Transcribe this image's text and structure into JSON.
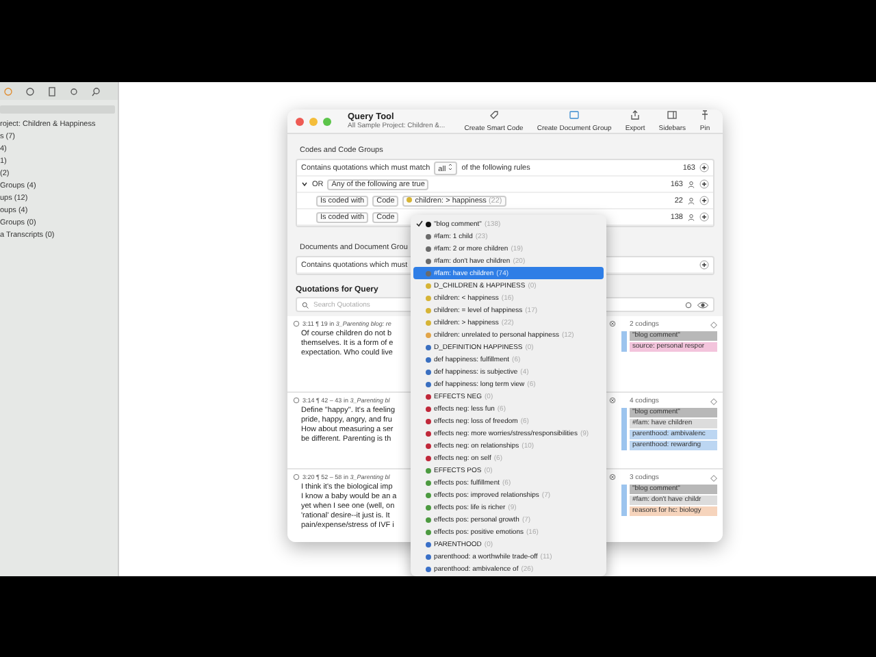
{
  "sidebar": {
    "items": [
      "roject: Children & Happiness",
      "s (7)",
      "4)",
      "1)",
      "(2)",
      "Groups (4)",
      "ups (12)",
      "oups (4)",
      "Groups (0)",
      "a Transcripts (0)"
    ]
  },
  "window": {
    "title": "Query Tool",
    "subtitle": "All Sample Project: Children &...",
    "toolbar": [
      {
        "kind": "smart-code",
        "label": "Create Smart Code"
      },
      {
        "kind": "document-group",
        "label": "Create Document Group"
      },
      {
        "kind": "export",
        "label": "Export"
      },
      {
        "kind": "sidebars",
        "label": "Sidebars"
      },
      {
        "kind": "pin",
        "label": "Pin"
      }
    ]
  },
  "codes_section": {
    "title": "Codes and Code Groups",
    "rules": [
      {
        "kind": "match",
        "text_before": "Contains quotations which must match",
        "choice": "all",
        "text_after": "of the following rules",
        "count": "163"
      },
      {
        "kind": "group",
        "expanded": true,
        "operator": "OR",
        "choice": "Any of the following are true",
        "count": "163"
      },
      {
        "kind": "condition",
        "field": "Is coded with",
        "type": "Code",
        "code": "children: > happiness",
        "code_count": "(22)",
        "count": "22"
      },
      {
        "kind": "condition",
        "field": "Is coded with",
        "type": "Code",
        "count": "138"
      }
    ]
  },
  "documents_section": {
    "title": "Documents and Document Grou",
    "rule": "Contains quotations which must"
  },
  "quotations": {
    "title": "Quotations for Query",
    "search": {
      "placeholder": "Search Quotations"
    },
    "items": [
      {
        "header": "3:11 ¶ 19 in *3_Parenting blog: re*",
        "lines": [
          "Of course children do not b",
          "themselves. It is a form of e",
          "expectation. Who could live"
        ],
        "codings": "2 codings",
        "tags": [
          {
            "label": "\"blog comment\"",
            "color": "#b8b8b8"
          },
          {
            "label": "source: personal respor",
            "color": "#f3c4dc"
          }
        ]
      },
      {
        "header": "3:14 ¶ 42 – 43 in *3_Parenting bl*",
        "lines": [
          "Define \"happy\". It's a feeling",
          "pride, happy, angry, and fru",
          "How about measuring a ser",
          "be different. Parenting is th"
        ],
        "codings": "4 codings",
        "tags": [
          {
            "label": "\"blog comment\"",
            "color": "#b8b8b8"
          },
          {
            "label": "#fam: have children",
            "color": "#dcdcdc"
          },
          {
            "label": "parenthood: ambivalenc",
            "color": "#bcd6f2"
          },
          {
            "label": "parenthood: rewarding",
            "color": "#bcd6f2"
          }
        ]
      },
      {
        "header": "3:20 ¶ 52 – 58 in *3_Parenting bl*",
        "lines": [
          "I think it's the biological imp",
          "I know a baby would be an a",
          "yet when I see one (well, on",
          "'rational' desire--it just is. It",
          "pain/expense/stress of IVF i"
        ],
        "codings": "3 codings",
        "tags": [
          {
            "label": "\"blog comment\"",
            "color": "#b8b8b8"
          },
          {
            "label": "#fam: don't have childr",
            "color": "#dcdcdc"
          },
          {
            "label": "reasons for hc: biology",
            "color": "#f6d4bc"
          }
        ]
      }
    ]
  },
  "menu": {
    "items": [
      {
        "label": "\"blog comment\"",
        "count": "(138)",
        "color": "#111111",
        "checked": true,
        "selected": false
      },
      {
        "label": "#fam: 1 child",
        "count": "(23)",
        "color": "#6b6b6b",
        "checked": false,
        "selected": false
      },
      {
        "label": "#fam: 2 or more  children",
        "count": "(19)",
        "color": "#6b6b6b",
        "checked": false,
        "selected": false
      },
      {
        "label": "#fam: don't have children",
        "count": "(20)",
        "color": "#6b6b6b",
        "checked": false,
        "selected": false
      },
      {
        "label": "#fam: have children",
        "count": "(74)",
        "color": "#6b6b6b",
        "checked": false,
        "selected": true
      },
      {
        "label": "D_CHILDREN & HAPPINESS",
        "count": "(0)",
        "color": "#d6b436",
        "checked": false,
        "selected": false
      },
      {
        "label": "children: < happiness",
        "count": "(16)",
        "color": "#d6b436",
        "checked": false,
        "selected": false
      },
      {
        "label": "children: = level of happiness",
        "count": "(17)",
        "color": "#d6b436",
        "checked": false,
        "selected": false
      },
      {
        "label": "children: > happiness",
        "count": "(22)",
        "color": "#d6b436",
        "checked": false,
        "selected": false
      },
      {
        "label": "children: unrelated to personal happiness",
        "count": "(12)",
        "color": "#e2a54a",
        "checked": false,
        "selected": false
      },
      {
        "label": "D_DEFINITION HAPPINESS",
        "count": "(0)",
        "color": "#3a6fc0",
        "checked": false,
        "selected": false
      },
      {
        "label": "def happiness: fulfillment",
        "count": "(6)",
        "color": "#3a6fc0",
        "checked": false,
        "selected": false
      },
      {
        "label": "def happiness: is subjective",
        "count": "(4)",
        "color": "#3a6fc0",
        "checked": false,
        "selected": false
      },
      {
        "label": "def happiness: long term view",
        "count": "(6)",
        "color": "#3a6fc0",
        "checked": false,
        "selected": false
      },
      {
        "label": "EFFECTS NEG",
        "count": "(0)",
        "color": "#c0283a",
        "checked": false,
        "selected": false
      },
      {
        "label": "effects neg: less fun",
        "count": "(6)",
        "color": "#c0283a",
        "checked": false,
        "selected": false
      },
      {
        "label": "effects neg: loss of freedom",
        "count": "(6)",
        "color": "#c0283a",
        "checked": false,
        "selected": false
      },
      {
        "label": "effects neg: more worries/stress/responsibilities",
        "count": "(9)",
        "color": "#c0283a",
        "checked": false,
        "selected": false
      },
      {
        "label": "effects neg: on relationships",
        "count": "(10)",
        "color": "#c0283a",
        "checked": false,
        "selected": false
      },
      {
        "label": "effects neg: on self",
        "count": "(6)",
        "color": "#c0283a",
        "checked": false,
        "selected": false
      },
      {
        "label": "EFFECTS POS",
        "count": "(0)",
        "color": "#4c9a40",
        "checked": false,
        "selected": false
      },
      {
        "label": "effects pos: fulfillment",
        "count": "(6)",
        "color": "#4c9a40",
        "checked": false,
        "selected": false
      },
      {
        "label": "effects pos: improved relationships",
        "count": "(7)",
        "color": "#4c9a40",
        "checked": false,
        "selected": false
      },
      {
        "label": "effects pos: life is richer",
        "count": "(9)",
        "color": "#4c9a40",
        "checked": false,
        "selected": false
      },
      {
        "label": "effects pos: personal growth",
        "count": "(7)",
        "color": "#4c9a40",
        "checked": false,
        "selected": false
      },
      {
        "label": "effects pos: positive emotions",
        "count": "(16)",
        "color": "#4c9a40",
        "checked": false,
        "selected": false
      },
      {
        "label": "PARENTHOOD",
        "count": "(0)",
        "color": "#3a70c8",
        "checked": false,
        "selected": false
      },
      {
        "label": "parenthood: a worthwhile trade-off",
        "count": "(11)",
        "color": "#3a70c8",
        "checked": false,
        "selected": false
      },
      {
        "label": "parenthood: ambivalence of",
        "count": "(26)",
        "color": "#3a70c8",
        "checked": false,
        "selected": false
      }
    ]
  }
}
